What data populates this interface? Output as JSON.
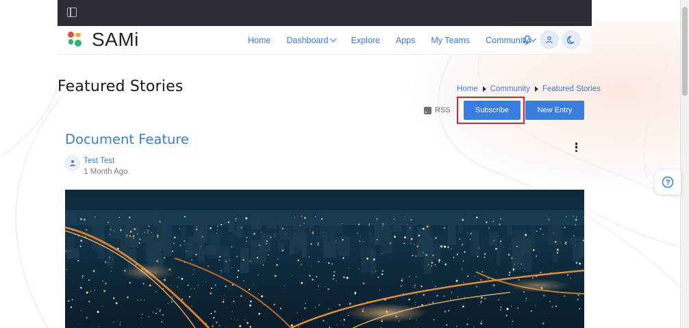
{
  "app": {
    "name": "SAMi"
  },
  "nav": {
    "items": [
      {
        "label": "Home",
        "dropdown": false
      },
      {
        "label": "Dashboard",
        "dropdown": true
      },
      {
        "label": "Explore",
        "dropdown": false
      },
      {
        "label": "Apps",
        "dropdown": false
      },
      {
        "label": "My Teams",
        "dropdown": false
      },
      {
        "label": "Community",
        "dropdown": true
      }
    ],
    "icons": [
      "bell-icon",
      "user-icon",
      "moon-icon"
    ]
  },
  "page": {
    "title": "Featured Stories"
  },
  "breadcrumb": [
    "Home",
    "Community",
    "Featured Stories"
  ],
  "actions": {
    "rss_label": "RSS",
    "subscribe_label": "Subscribe",
    "new_entry_label": "New Entry"
  },
  "entry": {
    "title": "Document Feature",
    "author": "Test Test",
    "time": "1 Month Ago"
  },
  "colors": {
    "accent": "#3a7bd5",
    "button": "#3a7ce0",
    "topbar": "#2c2d35",
    "highlight": "#e0202c"
  }
}
